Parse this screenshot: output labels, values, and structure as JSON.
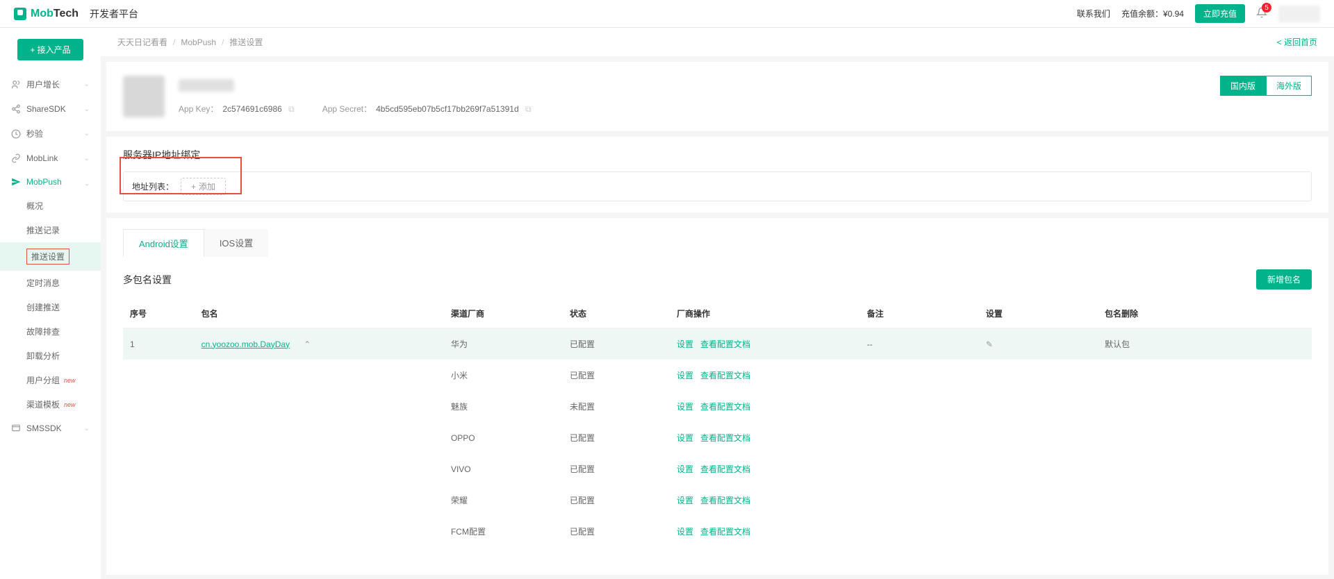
{
  "header": {
    "brand_mob": "Mob",
    "brand_tech": "Tech",
    "platform": "开发者平台",
    "contact": "联系我们",
    "balance_label": "充值余额：",
    "balance_value": "¥0.94",
    "recharge": "立即充值",
    "notif_count": "5"
  },
  "sidebar": {
    "connect": "+ 接入产品",
    "items": [
      {
        "icon": "user-growth-icon",
        "label": "用户增长"
      },
      {
        "icon": "share-icon",
        "label": "ShareSDK"
      },
      {
        "icon": "second-verify-icon",
        "label": "秒验"
      },
      {
        "icon": "moblink-icon",
        "label": "MobLink"
      },
      {
        "icon": "mobpush-icon",
        "label": "MobPush"
      },
      {
        "icon": "smssdk-icon",
        "label": "SMSSDK"
      }
    ],
    "mobpush_sub": [
      {
        "label": "概况"
      },
      {
        "label": "推送记录"
      },
      {
        "label": "推送设置",
        "active": true
      },
      {
        "label": "定时消息"
      },
      {
        "label": "创建推送"
      },
      {
        "label": "故障排查"
      },
      {
        "label": "卸载分析"
      },
      {
        "label": "用户分组",
        "new": "new"
      },
      {
        "label": "渠道模板",
        "new": "new"
      }
    ]
  },
  "breadcrumb": {
    "b1": "天天日记看看",
    "b2": "MobPush",
    "b3": "推送设置",
    "back": "< 返回首页"
  },
  "app": {
    "key_label": "App Key：",
    "key_value": "2c574691c6986",
    "secret_label": "App Secret：",
    "secret_value": "4b5cd595eb07b5cf17bb269f7a51391d",
    "tab_domestic": "国内版",
    "tab_overseas": "海外版"
  },
  "ip": {
    "title": "服务器IP地址绑定",
    "list_label": "地址列表：",
    "add": "添加"
  },
  "tabs": {
    "android": "Android设置",
    "ios": "IOS设置"
  },
  "pkg": {
    "title": "多包名设置",
    "add": "新增包名",
    "headers": {
      "seq": "序号",
      "name": "包名",
      "vendor": "渠道厂商",
      "status": "状态",
      "op": "厂商操作",
      "remark": "备注",
      "setting": "设置",
      "del": "包名删除"
    },
    "row": {
      "seq": "1",
      "name": "cn.yoozoo.mob.DayDay",
      "remark": "--",
      "del": "默认包"
    },
    "op_set": "设置",
    "op_doc": "查看配置文档",
    "vendors": [
      {
        "name": "华为",
        "status": "已配置"
      },
      {
        "name": "小米",
        "status": "已配置"
      },
      {
        "name": "魅族",
        "status": "未配置"
      },
      {
        "name": "OPPO",
        "status": "已配置"
      },
      {
        "name": "VIVO",
        "status": "已配置"
      },
      {
        "name": "荣耀",
        "status": "已配置"
      },
      {
        "name": "FCM配置",
        "status": "已配置"
      }
    ]
  }
}
